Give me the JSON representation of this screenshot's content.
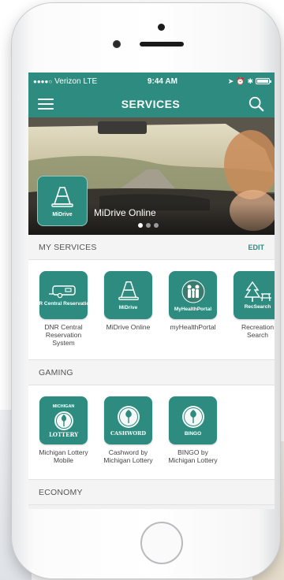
{
  "status_bar": {
    "carrier": "Verizon",
    "network": "LTE",
    "time": "9:44 AM"
  },
  "nav": {
    "title": "SERVICES"
  },
  "banner": {
    "tile_label": "MiDrive",
    "caption": "MiDrive Online",
    "pages": 3,
    "active_page": 1
  },
  "my_services": {
    "title": "MY SERVICES",
    "edit_label": "EDIT",
    "tiles": [
      {
        "icon_text": "DNR Central Reservations",
        "label": "DNR Central Reservation System",
        "icon": "trailer-icon"
      },
      {
        "icon_text": "MiDrive",
        "label": "MiDrive Online",
        "icon": "traffic-cone-icon"
      },
      {
        "icon_text": "MyHealthPortal",
        "label": "myHealthPortal",
        "icon": "family-icon"
      },
      {
        "icon_text": "RecSearch",
        "label": "Recreation Search",
        "icon": "trees-icon"
      }
    ]
  },
  "gaming": {
    "title": "GAMING",
    "tiles": [
      {
        "icon_text": "LOTTERY",
        "top_text": "MICHIGAN",
        "label": "Michigan Lottery Mobile",
        "icon": "lottery-icon"
      },
      {
        "icon_text": "CASHWORD",
        "label": "Cashword by Michigan Lottery",
        "icon": "cashword-icon"
      },
      {
        "icon_text": "BINGO",
        "label": "BINGO by Michigan Lottery",
        "icon": "bingo-icon"
      }
    ]
  },
  "economy": {
    "title": "ECONOMY"
  },
  "colors": {
    "accent": "#2d8c7f",
    "section_bg": "#f4f4f4"
  }
}
